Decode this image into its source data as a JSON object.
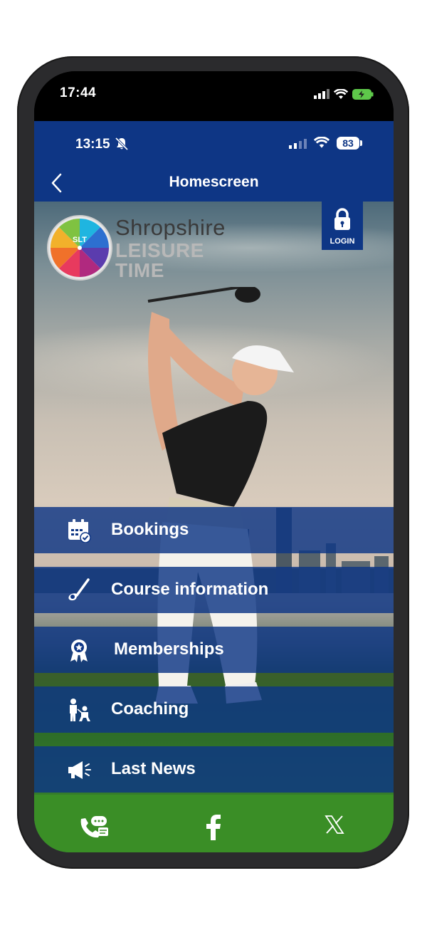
{
  "device": {
    "outer_time": "17:44"
  },
  "app_status": {
    "time": "13:15",
    "battery": "83"
  },
  "nav": {
    "title": "Homescreen"
  },
  "brand": {
    "line1": "Shropshire",
    "line2": "LEISURE",
    "line3": "TIME",
    "logo_text": "SLT"
  },
  "login": {
    "label": "LOGIN"
  },
  "menu": [
    {
      "label": "Bookings",
      "icon": "calendar-check-icon"
    },
    {
      "label": "Course information",
      "icon": "golf-club-icon"
    },
    {
      "label": "Memberships",
      "icon": "award-ribbon-icon"
    },
    {
      "label": "Coaching",
      "icon": "coaching-icon"
    },
    {
      "label": "Last News",
      "icon": "megaphone-icon"
    }
  ],
  "footer": {
    "icons": [
      "phone-chat-icon",
      "facebook-icon",
      "x-icon"
    ]
  },
  "colors": {
    "brand_blue": "#0e3685",
    "footer_green": "#3a8e26"
  }
}
